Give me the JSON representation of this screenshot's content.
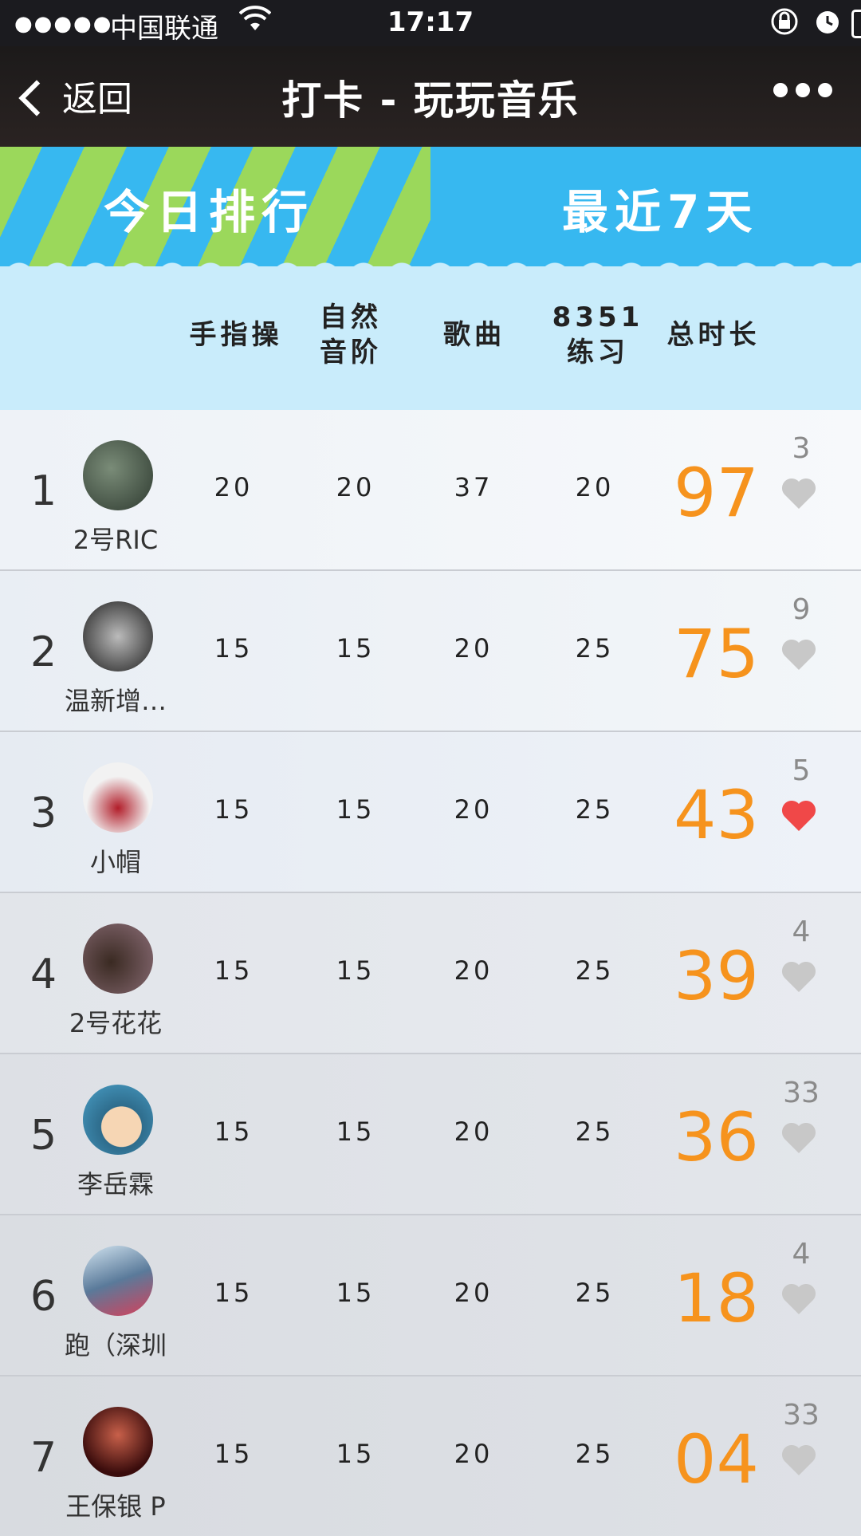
{
  "status_bar": {
    "signal": "●●●●●",
    "carrier": "中国联通",
    "time": "17:17"
  },
  "nav": {
    "back_label": "返回",
    "title": "打卡 - 玩玩音乐"
  },
  "tabs": {
    "today": "今日排行",
    "recent": "最近7天"
  },
  "columns": {
    "c1": "手指操",
    "c2a": "自然",
    "c2b": "音阶",
    "c3": "歌曲",
    "c4a": "8351",
    "c4b": "练习",
    "c5": "总时长"
  },
  "rows": [
    {
      "rank": "1",
      "name": "2号RIC",
      "c1": "20",
      "c2": "20",
      "c3": "37",
      "c4": "20",
      "total": "97",
      "likes": "3",
      "liked": false
    },
    {
      "rank": "2",
      "name": "温新增…",
      "c1": "15",
      "c2": "15",
      "c3": "20",
      "c4": "25",
      "total": "75",
      "likes": "9",
      "liked": false
    },
    {
      "rank": "3",
      "name": "小帽",
      "c1": "15",
      "c2": "15",
      "c3": "20",
      "c4": "25",
      "total": "43",
      "likes": "5",
      "liked": true
    },
    {
      "rank": "4",
      "name": "2号花花",
      "c1": "15",
      "c2": "15",
      "c3": "20",
      "c4": "25",
      "total": "39",
      "likes": "4",
      "liked": false
    },
    {
      "rank": "5",
      "name": "李岳霖",
      "c1": "15",
      "c2": "15",
      "c3": "20",
      "c4": "25",
      "total": "36",
      "likes": "33",
      "liked": false
    },
    {
      "rank": "6",
      "name": "跑（深圳",
      "c1": "15",
      "c2": "15",
      "c3": "20",
      "c4": "25",
      "total": "18",
      "likes": "4",
      "liked": false
    },
    {
      "rank": "7",
      "name": "王保银 P",
      "c1": "15",
      "c2": "15",
      "c3": "20",
      "c4": "25",
      "total": "04",
      "likes": "33",
      "liked": false
    }
  ],
  "colors": {
    "accent_total": "#f6931d",
    "heart_liked": "#f04848",
    "heart_unliked": "#c8c8c8",
    "tab_blue": "#37b8f0",
    "tab_green": "#9bd85b"
  }
}
